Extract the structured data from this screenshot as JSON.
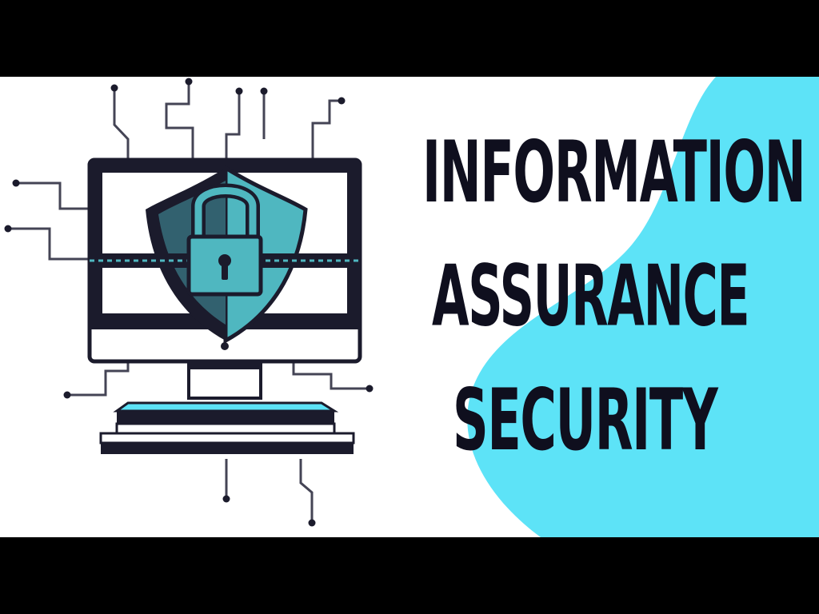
{
  "banner": {
    "headline_lines": [
      "INFORMATION",
      "ASSURANCE",
      "SECURITY"
    ]
  },
  "colors": {
    "background": "#ffffff",
    "accent_cyan": "#5de3f7",
    "ink": "#0f0f1e",
    "shield_teal": "#4fb7c0",
    "letterbox": "#000000"
  },
  "icons": {
    "illustration": "computer-monitor-with-shield-padlock-and-chain-icon",
    "circuit": "circuit-line-icon"
  }
}
